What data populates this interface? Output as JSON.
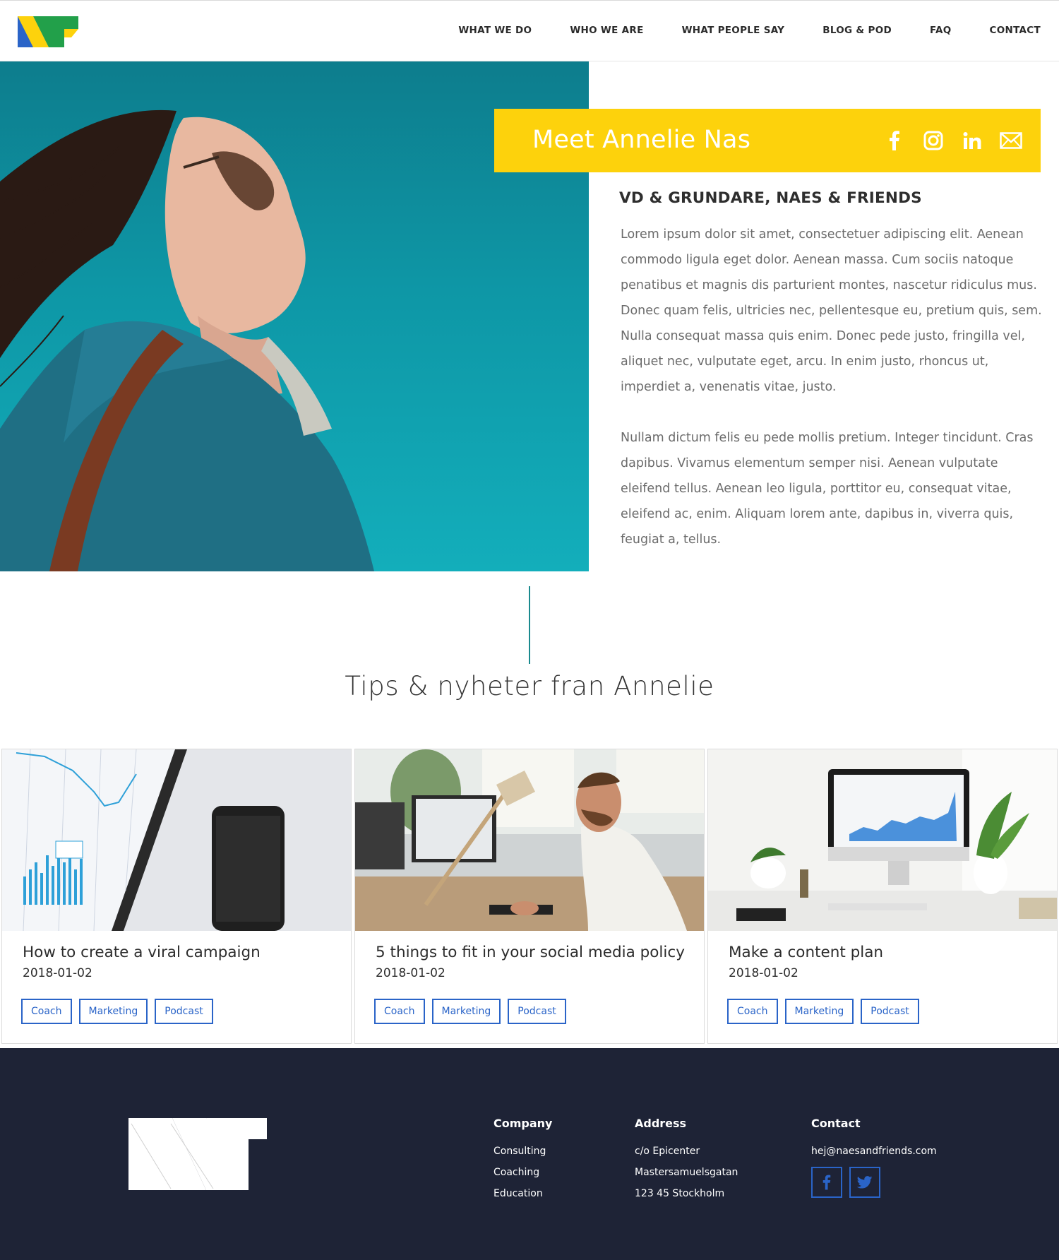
{
  "nav": {
    "items": [
      {
        "label": "WHAT WE DO"
      },
      {
        "label": "WHO WE ARE"
      },
      {
        "label": "WHAT PEOPLE SAY"
      },
      {
        "label": "BLOG & POD"
      },
      {
        "label": "FAQ"
      },
      {
        "label": "CONTACT"
      }
    ]
  },
  "hero": {
    "title": "Meet Annelie Nas",
    "social_icons": [
      "facebook-icon",
      "instagram-icon",
      "linkedin-icon",
      "mail-icon"
    ],
    "role": "VD & GRUNDARE, NAES & FRIENDS",
    "paragraph1": "Lorem ipsum dolor sit amet, consectetuer adipiscing elit. Aenean commodo ligula eget dolor. Aenean massa. Cum sociis natoque penatibus et magnis dis parturient montes, nascetur ridiculus mus. Donec quam felis, ultricies nec, pellentesque eu, pretium quis, sem. Nulla consequat massa quis enim. Donec pede justo, fringilla vel, aliquet nec, vulputate eget, arcu. In enim justo, rhoncus ut, imperdiet a, venenatis vitae, justo.",
    "paragraph2": "Nullam dictum felis eu pede mollis pretium. Integer tincidunt. Cras dapibus. Vivamus elementum semper nisi. Aenean vulputate eleifend tellus. Aenean leo ligula, porttitor eu, consequat vitae, eleifend ac, enim. Aliquam lorem ante, dapibus in, viverra quis, feugiat a, tellus.",
    "slider_active": 1,
    "slider_count": 3
  },
  "section": {
    "title": "Tips & nyheter fran Annelie"
  },
  "cards": [
    {
      "title": "How to create a viral campaign",
      "date": "2018-01-02",
      "tags": [
        "Coach",
        "Marketing",
        "Podcast"
      ]
    },
    {
      "title": "5 things to fit in your social media policy",
      "date": "2018-01-02",
      "tags": [
        "Coach",
        "Marketing",
        "Podcast"
      ]
    },
    {
      "title": "Make a content plan",
      "date": "2018-01-02",
      "tags": [
        "Coach",
        "Marketing",
        "Podcast"
      ]
    }
  ],
  "footer": {
    "company": {
      "heading": "Company",
      "items": [
        "Consulting",
        "Coaching",
        "Education"
      ]
    },
    "address": {
      "heading": "Address",
      "items": [
        "c/o Epicenter",
        "Mastersamuelsgatan",
        "123 45 Stockholm"
      ]
    },
    "contact": {
      "heading": "Contact",
      "email": "hej@naesandfriends.com",
      "social_icons": [
        "facebook-icon",
        "twitter-icon"
      ]
    }
  },
  "colors": {
    "accent_yellow": "#fdd20c",
    "tag_blue": "#2a64c8",
    "footer_bg": "#1e2336",
    "hero_teal": "#0e97a6",
    "logo_blue": "#2a64c8",
    "logo_green": "#22a04a",
    "logo_yellow": "#fdd20c"
  }
}
